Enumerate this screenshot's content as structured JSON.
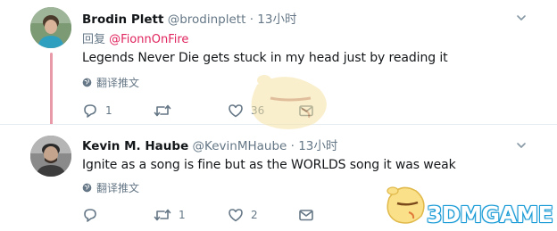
{
  "tweets": [
    {
      "name": "Brodin Plett",
      "handle": "@brodinplett",
      "separator": "·",
      "time": "13小时",
      "reply_label": "回复",
      "reply_mention": "@FionnOnFire",
      "text": "Legends Never Die gets stuck in my head just by reading it",
      "translate_label": "翻译推文",
      "reply_count": "1",
      "retweet_count": "",
      "like_count": "36"
    },
    {
      "name": "Kevin M. Haube",
      "handle": "@KevinMHaube",
      "separator": "·",
      "time": "13小时",
      "text": "Ignite as a song is fine but as the WORLDS song it was weak",
      "translate_label": "翻译推文",
      "reply_count": "",
      "retweet_count": "1",
      "like_count": "2"
    }
  ],
  "watermark": {
    "text": "3DMGAME"
  },
  "colors": {
    "thread_line": "#e99aa9",
    "mention": "#e0245e",
    "secondary_text": "#657786",
    "watermark_outline": "#1c9cd6"
  }
}
